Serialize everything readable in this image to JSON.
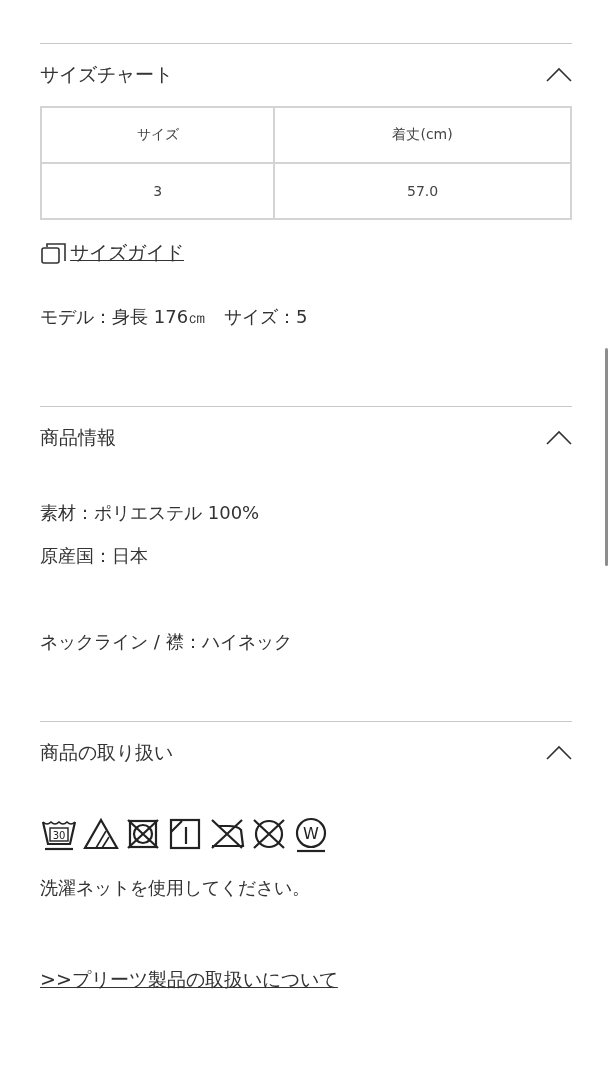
{
  "sections": [
    {
      "title": "サイズチャート",
      "expanded": true,
      "kind": "size"
    },
    {
      "title": "商品情報",
      "expanded": true,
      "kind": "info"
    },
    {
      "title": "商品の取り扱い",
      "expanded": true,
      "kind": "care"
    }
  ],
  "size_chart": {
    "columns": [
      "サイズ",
      "着丈(cm)"
    ],
    "rows": [
      [
        "3",
        "57.0"
      ]
    ],
    "guide_link": "サイズガイド",
    "model_note": "モデル：身長 176㎝　サイズ：5"
  },
  "product_info": {
    "lines": [
      "素材：ポリエステル 100%",
      "原産国：日本"
    ],
    "extra_lines": [
      "ネックライン / 襟：ハイネック"
    ]
  },
  "care": {
    "symbols": [
      {
        "kind": "wash",
        "text": "30"
      },
      {
        "kind": "bleach"
      },
      {
        "kind": "tumble-no"
      },
      {
        "kind": "shade-dry"
      },
      {
        "kind": "iron-no"
      },
      {
        "kind": "dryclean-no"
      },
      {
        "kind": "wetclean",
        "text": "W"
      }
    ],
    "note": "洗濯ネットを使用してください。",
    "link": ">>プリーツ製品の取扱いについて"
  }
}
